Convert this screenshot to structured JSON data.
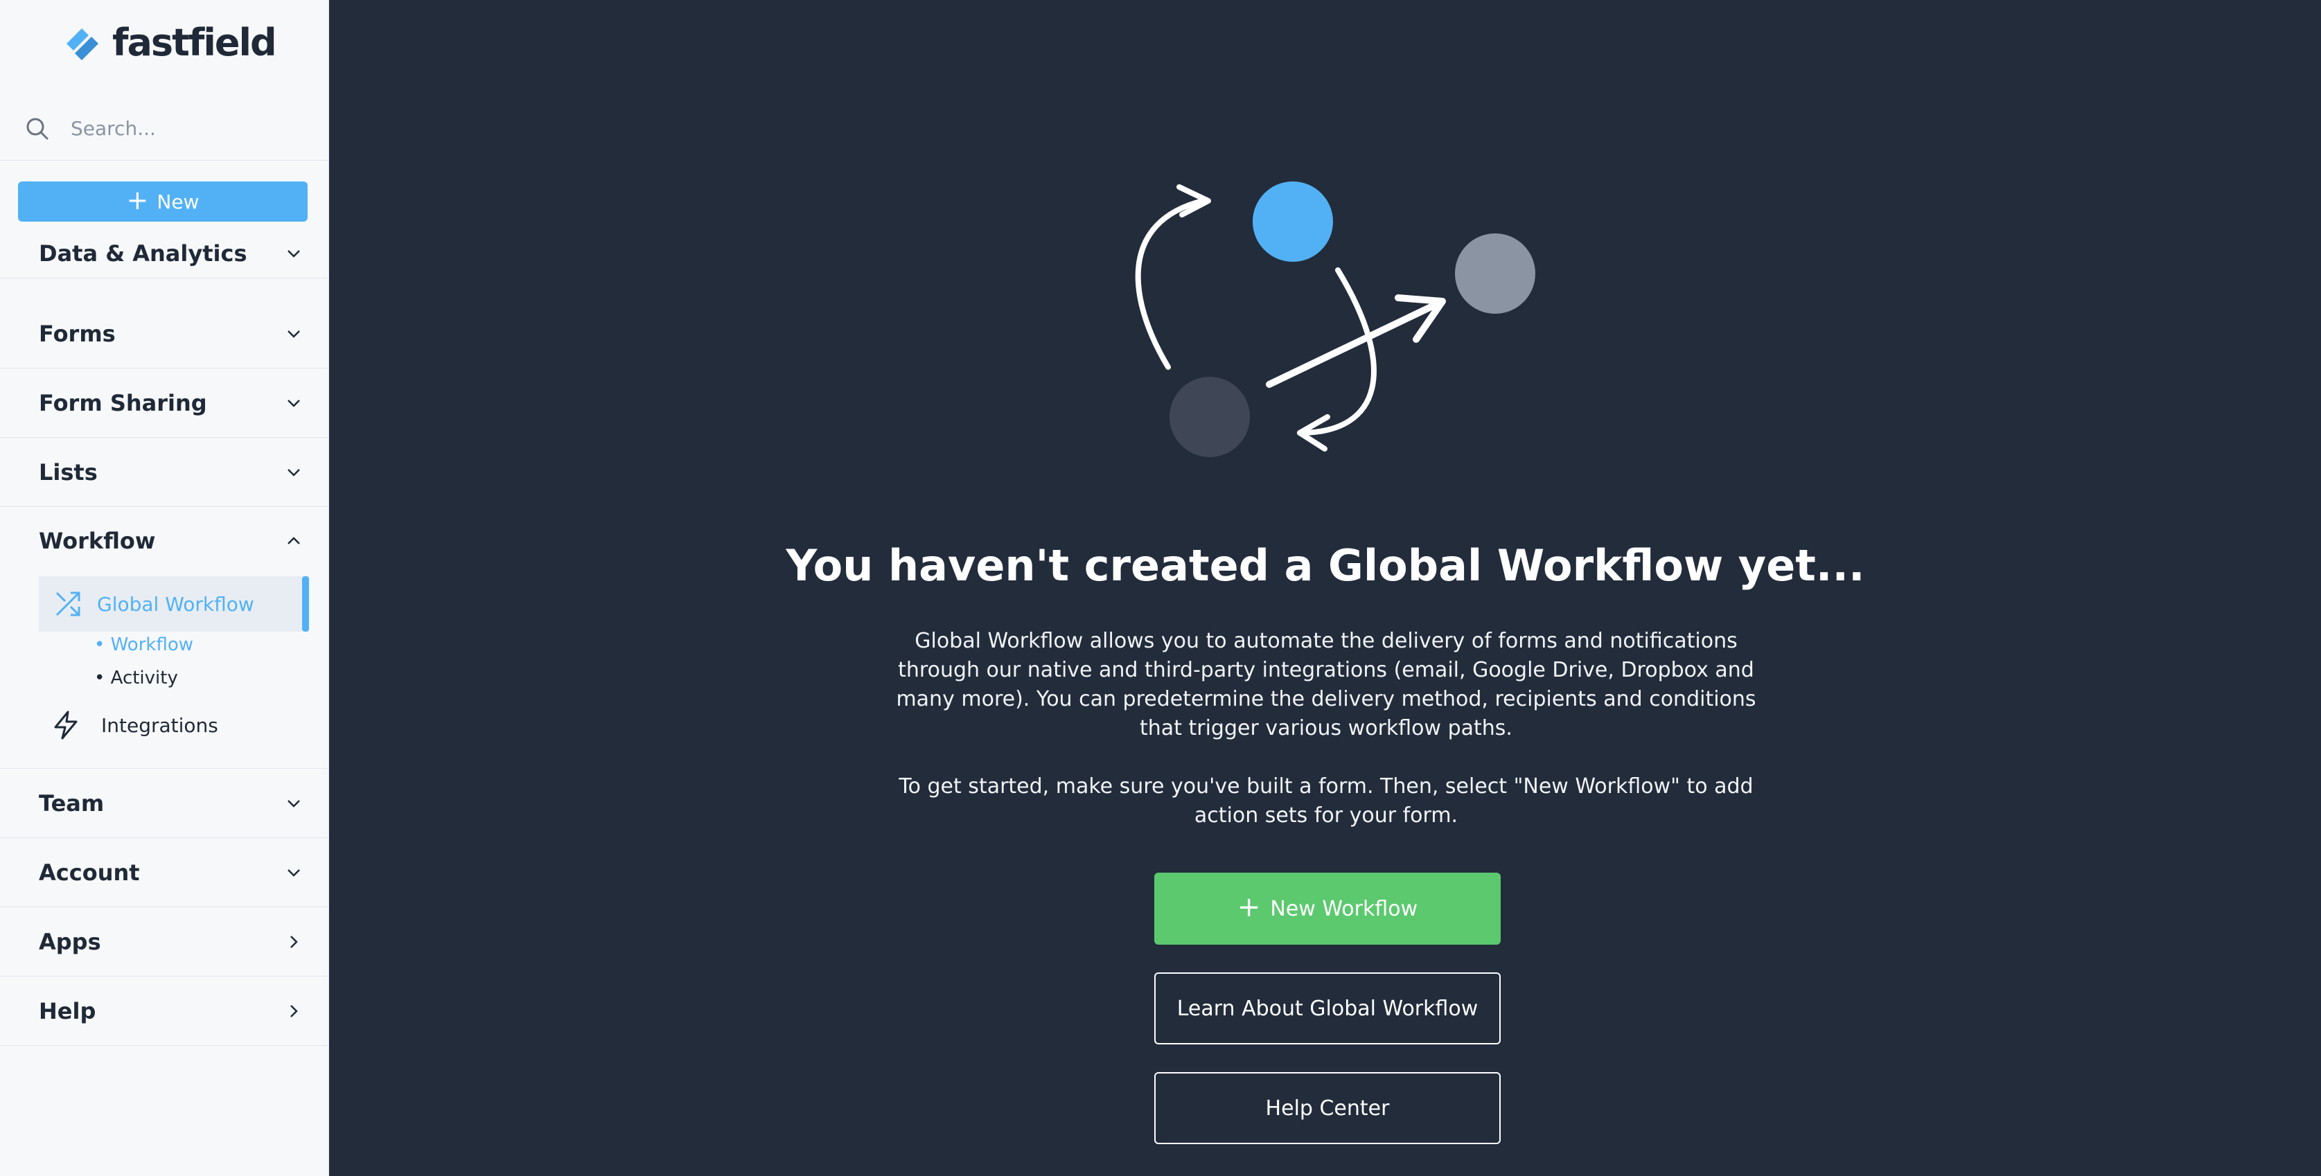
{
  "brand": {
    "name": "fastfield",
    "accent": "#52b1f5"
  },
  "search": {
    "placeholder": "Search..."
  },
  "sidebar": {
    "new_label": "New",
    "sections": [
      {
        "label": "Data & Analytics",
        "state": "collapsed"
      },
      {
        "label": "Forms",
        "state": "collapsed"
      },
      {
        "label": "Form Sharing",
        "state": "collapsed"
      },
      {
        "label": "Lists",
        "state": "collapsed"
      },
      {
        "label": "Workflow",
        "state": "expanded"
      },
      {
        "label": "Team",
        "state": "collapsed"
      },
      {
        "label": "Account",
        "state": "collapsed"
      },
      {
        "label": "Apps",
        "state": "link"
      },
      {
        "label": "Help",
        "state": "link"
      }
    ],
    "workflow_menu": {
      "global_workflow": "Global Workflow",
      "sub_items": [
        "Workflow",
        "Activity"
      ],
      "integrations": "Integrations"
    }
  },
  "main": {
    "headline": "You haven't created a Global Workflow yet...",
    "paragraph1": "Global Workflow allows you to automate the delivery of forms and notifications through our native and third-party integrations (email, Google Drive, Dropbox and many more). You can predetermine the delivery method, recipients and conditions that trigger various workflow paths.",
    "paragraph2": "To get started, make sure you've built a form. Then, select \"New Workflow\" to add action sets for your form.",
    "buttons": {
      "new_workflow": "New Workflow",
      "learn": "Learn About Global Workflow",
      "help_center": "Help Center"
    }
  },
  "colors": {
    "background": "#222c3b",
    "sidebar": "#f7f8fa",
    "green": "#5cc96f",
    "blue": "#52b1f5"
  }
}
